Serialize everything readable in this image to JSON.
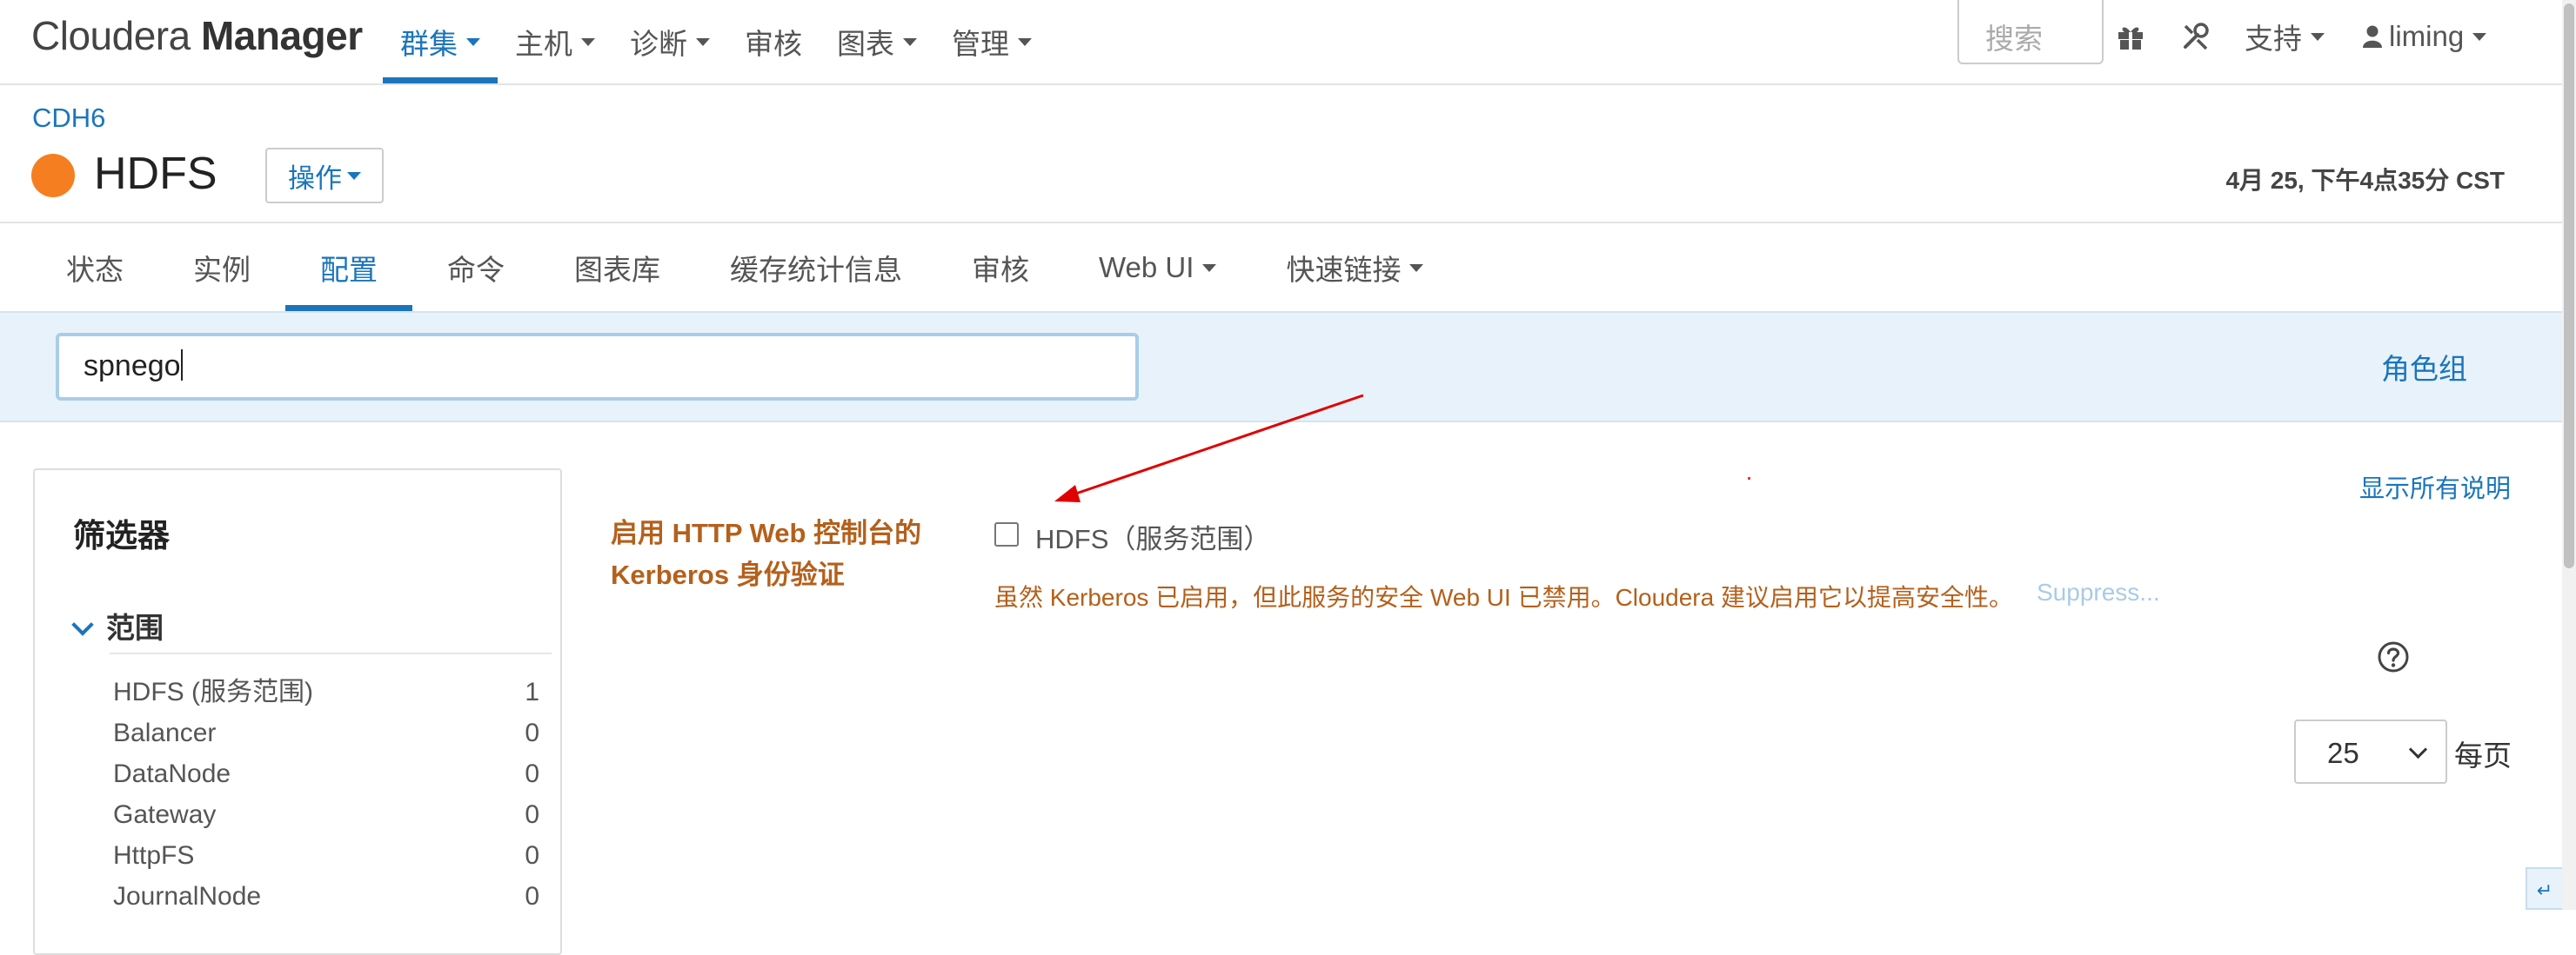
{
  "header": {
    "logo_light": "Cloudera",
    "logo_bold": "Manager",
    "nav": [
      {
        "label": "群集",
        "dropdown": true,
        "active": true
      },
      {
        "label": "主机",
        "dropdown": true
      },
      {
        "label": "诊断",
        "dropdown": true
      },
      {
        "label": "审核",
        "dropdown": false
      },
      {
        "label": "图表",
        "dropdown": true
      },
      {
        "label": "管理",
        "dropdown": true
      }
    ],
    "search_placeholder": "搜索",
    "support_label": "支持",
    "user_label": "liming",
    "icons": [
      "gift-icon",
      "tools-icon",
      "user-icon"
    ]
  },
  "service": {
    "breadcrumb": "CDH6",
    "name": "HDFS",
    "status_color": "#f57f20",
    "actions_label": "操作",
    "timestamp": "4月 25, 下午4点35分 CST"
  },
  "subnav": [
    {
      "label": "状态"
    },
    {
      "label": "实例"
    },
    {
      "label": "配置",
      "active": true
    },
    {
      "label": "命令"
    },
    {
      "label": "图表库"
    },
    {
      "label": "缓存统计信息"
    },
    {
      "label": "审核"
    },
    {
      "label": "Web UI",
      "dropdown": true
    },
    {
      "label": "快速链接",
      "dropdown": true
    }
  ],
  "filter": {
    "value": "spnego",
    "role_group_label": "角色组"
  },
  "sidebar": {
    "title": "筛选器",
    "scope_title": "范围",
    "scopes": [
      {
        "name": "HDFS (服务范围)",
        "count": "1"
      },
      {
        "name": "Balancer",
        "count": "0"
      },
      {
        "name": "DataNode",
        "count": "0"
      },
      {
        "name": "Gateway",
        "count": "0"
      },
      {
        "name": "HttpFS",
        "count": "0"
      },
      {
        "name": "JournalNode",
        "count": "0"
      }
    ]
  },
  "config": {
    "show_all_desc": "显示所有说明",
    "property_label": "启用 HTTP Web 控制台的 Kerberos 身份验证",
    "scope_value": "HDFS（服务范围）",
    "checked": false,
    "warning": "虽然 Kerberos 已启用，但此服务的安全 Web UI 已禁用。Cloudera 建议启用它以提高安全性。",
    "suppress_label": "Suppress...",
    "per_page_value": "25",
    "per_page_label": "每页"
  },
  "colors": {
    "accent": "#1b75bb",
    "warning": "#b4601b",
    "annotation_arrow": "#e00000"
  }
}
